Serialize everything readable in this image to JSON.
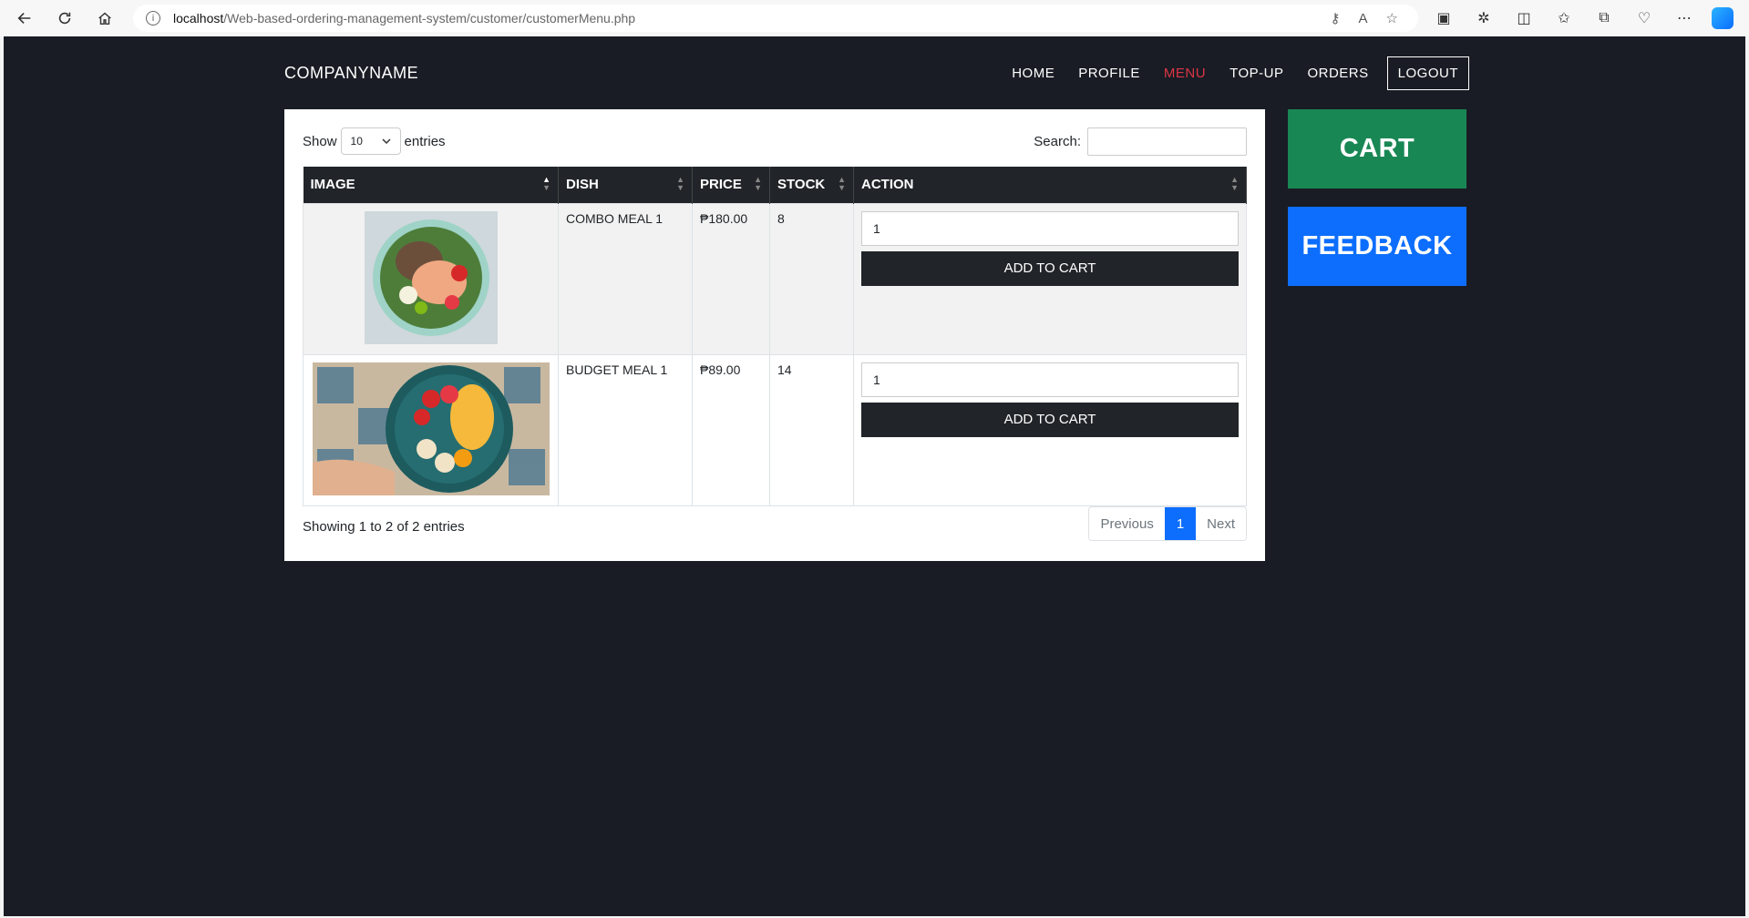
{
  "browser": {
    "url_host": "localhost",
    "url_path": "/Web-based-ordering-management-system/customer/customerMenu.php"
  },
  "navbar": {
    "brand": "COMPANYNAME",
    "items": [
      {
        "label": "HOME",
        "active": false
      },
      {
        "label": "PROFILE",
        "active": false
      },
      {
        "label": "MENU",
        "active": true
      },
      {
        "label": "TOP-UP",
        "active": false
      },
      {
        "label": "ORDERS",
        "active": false
      }
    ],
    "logout": "LOGOUT"
  },
  "table_controls": {
    "show_label": "Show",
    "entries_value": "10",
    "entries_label": "entries",
    "search_label": "Search:",
    "search_value": ""
  },
  "table": {
    "headers": [
      "IMAGE",
      "DISH",
      "PRICE",
      "STOCK",
      "ACTION"
    ],
    "rows": [
      {
        "image": "salad-bowl-image",
        "dish": "COMBO MEAL 1",
        "price": "₱180.00",
        "stock": "8",
        "qty": "1",
        "button": "ADD TO CART"
      },
      {
        "image": "fruit-plate-image",
        "dish": "BUDGET MEAL 1",
        "price": "₱89.00",
        "stock": "14",
        "qty": "1",
        "button": "ADD TO CART"
      }
    ]
  },
  "footer": {
    "info": "Showing 1 to 2 of 2 entries",
    "previous": "Previous",
    "current_page": "1",
    "next": "Next"
  },
  "side": {
    "cart": "CART",
    "feedback": "FEEDBACK"
  },
  "colors": {
    "page_bg": "#191c24",
    "active_nav": "#dc3545",
    "cart": "#198754",
    "feedback": "#0d6efd",
    "table_header": "#212529"
  }
}
